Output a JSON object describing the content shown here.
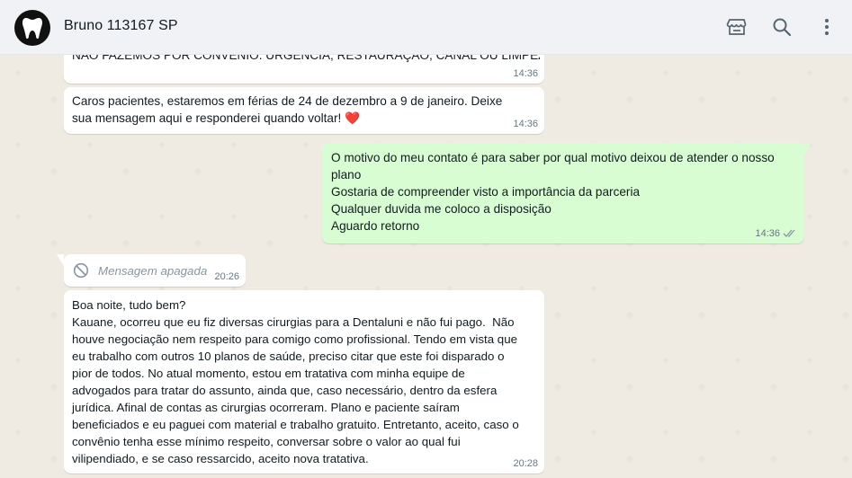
{
  "header": {
    "contact_name": "Bruno 113167 SP",
    "icons": [
      "tooth-avatar",
      "store-icon",
      "search-icon",
      "more-vert-icon"
    ]
  },
  "messages": [
    {
      "id": "m1",
      "direction": "in",
      "text": "NÃO FAZEMOS POR CONVÊNIO. URGÊNCIA, RESTAURAÇÃO, CANAL OU LIMPEZA",
      "time": "14:36"
    },
    {
      "id": "m2",
      "direction": "in",
      "text": "Caros pacientes, estaremos em férias de 24 de dezembro a 9 de janeiro. Deixe sua mensagem aqui e responderei quando voltar! ❤️",
      "time": "14:36"
    },
    {
      "id": "m3",
      "direction": "out",
      "lines": [
        "O motivo do meu contato é para saber por qual motivo deixou de atender o nosso plano",
        "Gostaria de compreender visto a importância da parceria",
        "Qualquer duvida me coloco a disposição",
        "Aguardo retorno"
      ],
      "time": "14:36",
      "status": "read-ticks"
    },
    {
      "id": "m4",
      "direction": "in",
      "deleted": true,
      "text": "Mensagem apagada",
      "time": "20:26"
    },
    {
      "id": "m5",
      "direction": "in",
      "text": "Boa noite, tudo bem?\nKauane, ocorreu que eu fiz diversas cirurgias para a Dentaluni e não fui pago.  Não houve negociação nem respeito para comigo como profissional. Tendo em vista que eu trabalho com outros 10 planos de saúde, preciso citar que este foi disparado o pior de todos. No atual momento, estou em tratativa com minha equipe de advogados para tratar do assunto, ainda que, caso necessário, dentro da esfera jurídica. Afinal de contas as cirurgias ocorreram. Plano e paciente saíram beneficiados e eu paguei com material e trabalho gratuito. Entretanto, aceito, caso o convênio tenha esse mínimo respeito, conversar sobre o valor ao qual fui vilipendiado, e se caso ressarcido, aceito nova tratativa.",
      "time": "20:28"
    }
  ],
  "colors": {
    "incoming": "#ffffff",
    "outgoing": "#d9fdd3",
    "background": "#efeae2",
    "header": "#f0f2f5",
    "meta": "#667781"
  }
}
